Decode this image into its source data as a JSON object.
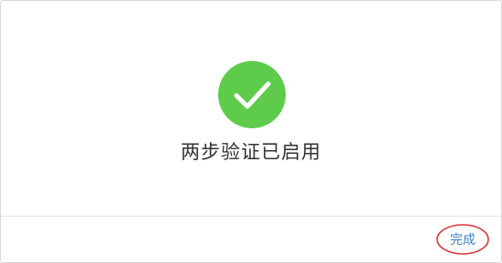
{
  "dialog": {
    "message": "两步验证已启用",
    "status_icon": "check-circle-icon",
    "accent_color": "#5ecb4b"
  },
  "footer": {
    "done_label": "完成",
    "link_color": "#3b7fc4",
    "annotation_color": "#d9363e"
  }
}
